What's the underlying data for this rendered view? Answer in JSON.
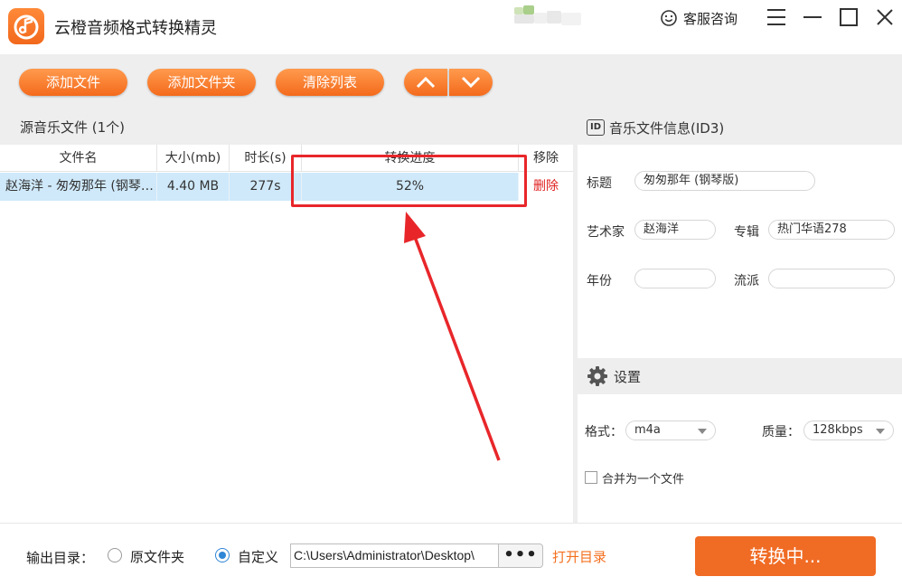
{
  "app": {
    "title": "云橙音频格式转换精灵",
    "service_label": "客服咨询",
    "brand_color": "#f46a1c"
  },
  "icons": {
    "logo": "music-note-logo-icon",
    "service": "smile-headset-icon",
    "menu": "hamburger-menu-icon",
    "minimize": "minimize-icon",
    "maximize": "maximize-icon",
    "close": "close-icon",
    "move_up": "chevron-up-icon",
    "move_down": "chevron-down-icon",
    "settings": "gear-icon"
  },
  "toolbar": {
    "add_file": "添加文件",
    "add_folder": "添加文件夹",
    "clear_list": "清除列表"
  },
  "file_list": {
    "header": "源音乐文件 (1个)",
    "columns": [
      "文件名",
      "大小(mb)",
      "时长(s)",
      "转换进度",
      "移除"
    ],
    "rows": [
      {
        "name": "赵海洋 - 匆匆那年 (钢琴…",
        "size": "4.40 MB",
        "duration": "277s",
        "progress": "52%",
        "remove": "删除"
      }
    ]
  },
  "id3": {
    "header": "音乐文件信息(ID3)",
    "badge": "ID",
    "title_label": "标题",
    "title_value": "匆匆那年 (钢琴版)",
    "artist_label": "艺术家",
    "artist_value": "赵海洋",
    "album_label": "专辑",
    "album_value": "热门华语278",
    "year_label": "年份",
    "year_value": "",
    "genre_label": "流派",
    "genre_value": ""
  },
  "settings": {
    "header": "设置",
    "format_label": "格式：",
    "format_value": "m4a",
    "quality_label": "质量：",
    "quality_value": "128kbps",
    "merge_label": "合并为一个文件",
    "merge_checked": false
  },
  "output": {
    "label": "输出目录：",
    "option_original": "原文件夹",
    "option_custom": "自定义",
    "selected": "custom",
    "path": "C:\\Users\\Administrator\\Desktop\\",
    "browse_label": "•••",
    "open_dir": "打开目录",
    "convert_label": "转换中..."
  },
  "annotation": {
    "color": "#e8262a"
  }
}
